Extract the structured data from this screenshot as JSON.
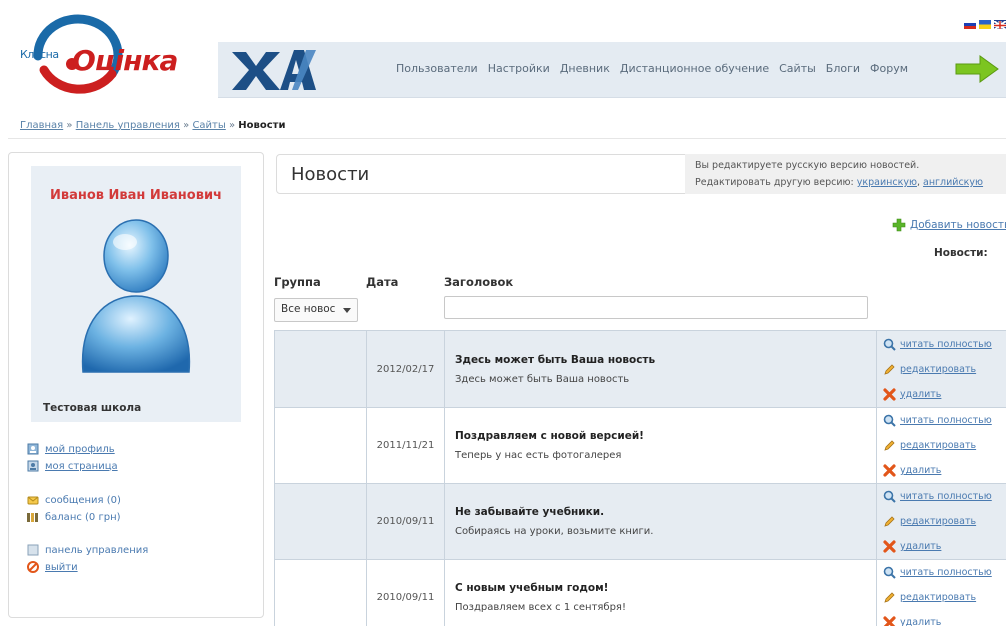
{
  "logo": {
    "small": "Класна",
    "big": "Оцінка"
  },
  "topnav": {
    "items": [
      "Пользователи",
      "Настройки",
      "Дневник",
      "Дистанционное обучение",
      "Сайты",
      "Блоги",
      "Форум"
    ]
  },
  "breadcrumb": {
    "items": [
      "Главная",
      "Панель управления",
      "Сайты"
    ],
    "separator": "»",
    "current": "Новости"
  },
  "profile": {
    "name": "Иванов Иван Иванович",
    "school": "Тестовая школа"
  },
  "sidebar_links": [
    {
      "label": "мой профиль",
      "icon": "profile-icon"
    },
    {
      "label": "моя страница",
      "icon": "page-icon"
    },
    {
      "label": "сообщения (0)",
      "icon": "envelope-icon"
    },
    {
      "label": "баланс (0 грн)",
      "icon": "wallet-icon"
    },
    {
      "label": "панель управления",
      "icon": "panel-icon"
    },
    {
      "label": "выйти",
      "icon": "logout-icon"
    }
  ],
  "news": {
    "title": "Новости",
    "note_line1": "Вы редактируете русскую версию новостей.",
    "note_line2_prefix": "Редактировать другую версию:",
    "note_lang1": "украинскую",
    "note_lang2": "английскую",
    "add_label": "Добавить новость",
    "count_label": "Новости:"
  },
  "filters": {
    "group_label": "Группа",
    "date_label": "Дата",
    "title_label": "Заголовок",
    "group_value": "Все новос",
    "title_value": ""
  },
  "actions": {
    "read": "читать полностью",
    "edit": "редактировать",
    "delete": "удалить"
  },
  "rows": [
    {
      "date": "2012/02/17",
      "title": "Здесь может быть Ваша новость",
      "summary": "Здесь может быть Ваша новость"
    },
    {
      "date": "2011/11/21",
      "title": "Поздравляем с новой версией!",
      "summary": "Теперь у нас есть фотогалерея"
    },
    {
      "date": "2010/09/11",
      "title": "Не забывайте учебники.",
      "summary": "Собираясь на уроки, возьмите книги."
    },
    {
      "date": "2010/09/11",
      "title": "С новым учебным годом!",
      "summary": "Поздравляем всех с 1 сентября!"
    }
  ],
  "colors": {
    "brand_red": "#cc1f1f",
    "brand_blue": "#1a6aa8",
    "link": "#4a7ab0",
    "row_alt": "#e6ecf2",
    "arrow_green": "#7cc520"
  }
}
